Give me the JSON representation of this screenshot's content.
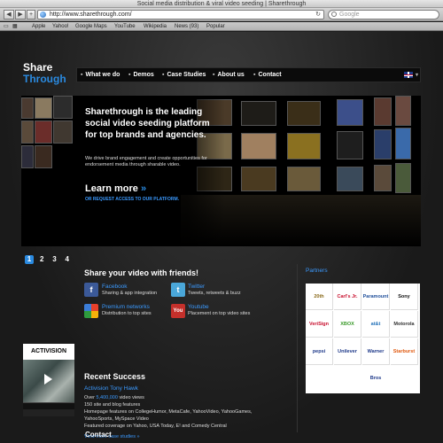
{
  "browser": {
    "title": "Social media distribution & viral video seeding | Sharethrough",
    "url": "http://www.sharethrough.com/",
    "search_placeholder": "Google",
    "bookmarks": [
      "Apple",
      "Yahoo!",
      "Google Maps",
      "YouTube",
      "Wikipedia",
      "News (93)",
      "Popular"
    ]
  },
  "logo": {
    "line1": "Share",
    "line2": "Through"
  },
  "nav": [
    "What we do",
    "Demos",
    "Case Studies",
    "About us",
    "Contact"
  ],
  "hero": {
    "title": "Sharethrough is the leading social video seeding platform for top brands and agencies.",
    "subtitle": "We drive brand engagement and create opportunities for endorsement media through sharable video.",
    "cta": "Learn more",
    "cta_arrows": "»",
    "request": "OR REQUEST ACCESS TO OUR PLATFORM."
  },
  "pager": [
    "1",
    "2",
    "3",
    "4"
  ],
  "share": {
    "heading": "Share your video with friends!",
    "items": [
      {
        "icon": "facebook-icon",
        "glyph": "f",
        "color": "#3b5998",
        "title": "Facebook",
        "desc": "Sharing & app integration"
      },
      {
        "icon": "twitter-icon",
        "glyph": "t",
        "color": "#4aa7d9",
        "title": "Twitter",
        "desc": "Tweets, retweets & buzz"
      },
      {
        "icon": "premium-networks-icon",
        "glyph": "",
        "color": "#4a9a3a",
        "title": "Premium networks",
        "desc": "Distribution to top sites"
      },
      {
        "icon": "youtube-icon",
        "glyph": "You",
        "color": "#c4302b",
        "title": "Youtube",
        "desc": "Placement on top video sites"
      }
    ]
  },
  "partners": {
    "heading": "Partners",
    "logos": [
      "20th Century Fox",
      "Carl's Jr.",
      "Paramount",
      "Sony Pictures",
      "VeriSign",
      "XBOX",
      "at&t",
      "Motorola",
      "pepsi",
      "Unilever",
      "Warner Bros",
      "Starburst"
    ]
  },
  "recent": {
    "heading": "Recent Success",
    "video_logo": "ACTIVISION",
    "subtitle": "Activision Tony Hawk",
    "lines": [
      {
        "pre": "Over ",
        "hl": "5,400,000",
        "post": " video views"
      },
      {
        "pre": "150 site and blog features",
        "hl": "",
        "post": ""
      },
      {
        "pre": "Homepage features on CollegeHumor, MetaCafe, YahooVideo, YahooGames,",
        "hl": "",
        "post": ""
      },
      {
        "pre": "YahooSports, MySpace Video",
        "hl": "",
        "post": ""
      },
      {
        "pre": "Featured coverage on Yahoo, USA Today, E! and Comedy Central",
        "hl": "",
        "post": ""
      }
    ],
    "more": "View more case studies »"
  },
  "contact_heading": "Contact"
}
